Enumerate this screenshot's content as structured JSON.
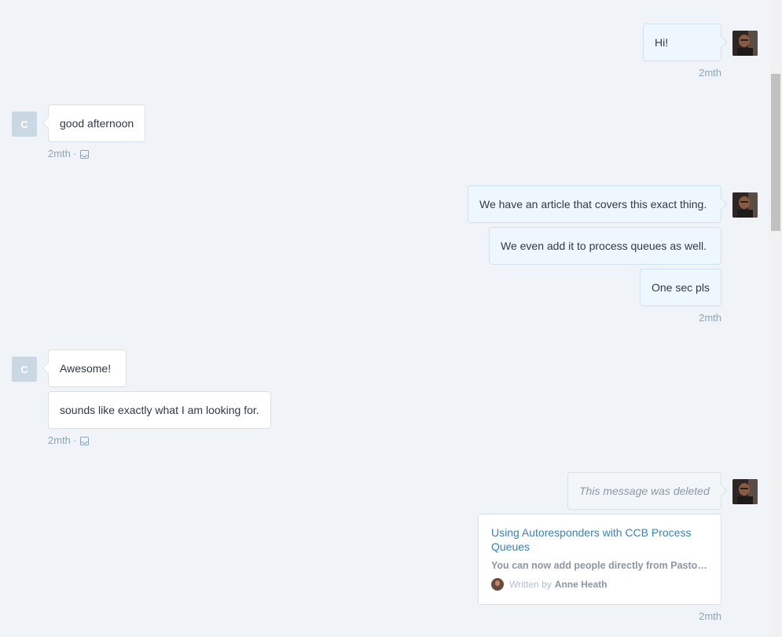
{
  "conversation": {
    "groups": [
      {
        "messages": [
          "Hi!"
        ],
        "time": "2mth"
      },
      {
        "messages": [
          "good afternoon"
        ],
        "time": "2mth",
        "avatar_letter": "C"
      },
      {
        "messages": [
          "We have an article that covers this exact thing.",
          "We even add it to process queues as well.",
          "One sec pls"
        ],
        "time": "2mth"
      },
      {
        "messages": [
          "Awesome!",
          "sounds like exactly what I am looking for."
        ],
        "time": "2mth",
        "avatar_letter": "C"
      },
      {
        "messages": [
          "This message was deleted"
        ],
        "time": "2mth"
      }
    ],
    "article": {
      "title": "Using Autoresponders with CCB Process Queues",
      "summary": "You can now add people directly from Pastor...",
      "written_by": "Written by",
      "author": "Anne Heath"
    },
    "separator": "·"
  },
  "icons": {
    "seen": "tray-icon",
    "agent_avatar": "agent-photo-avatar"
  }
}
